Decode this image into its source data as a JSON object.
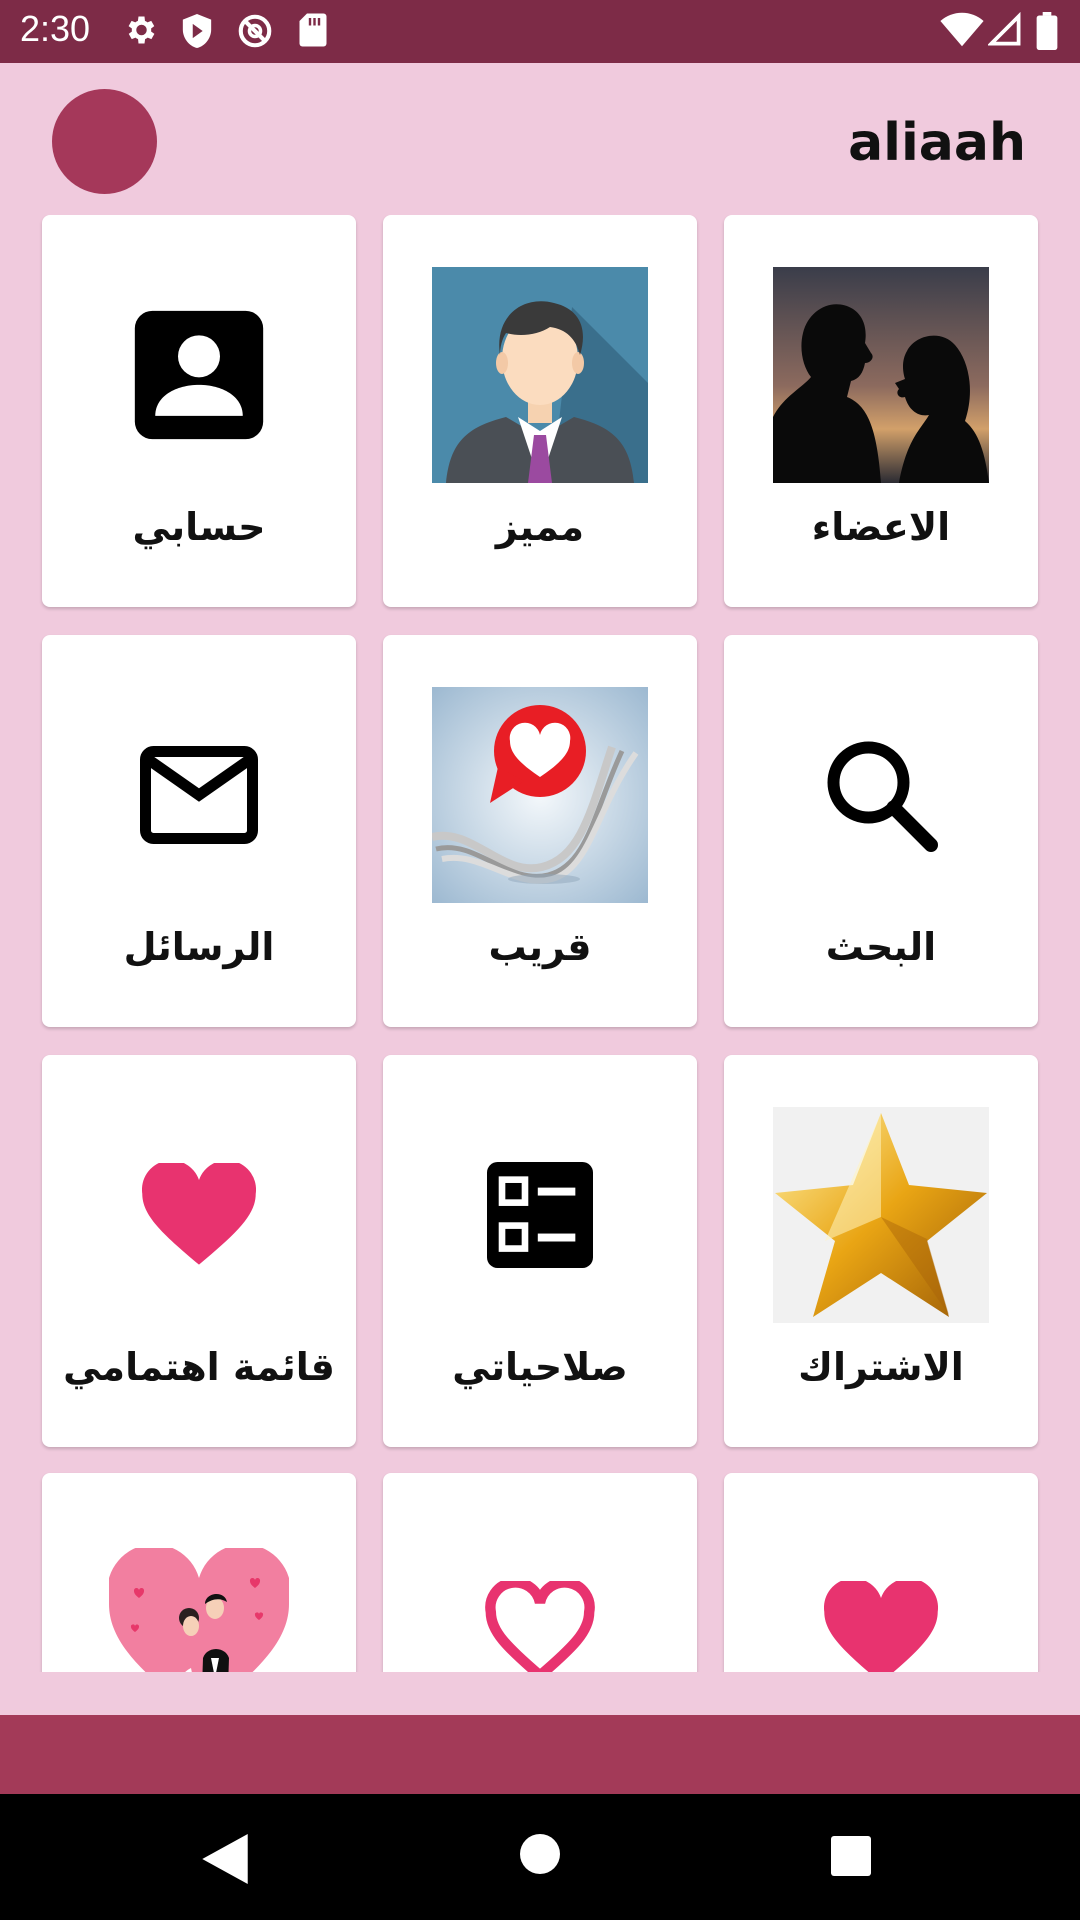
{
  "status_bar": {
    "time": "2:30",
    "icons_left": [
      "gear-icon",
      "shield-icon",
      "no-disturb-icon",
      "sd-card-icon"
    ],
    "icons_right": [
      "wifi-icon",
      "signal-icon",
      "battery-icon"
    ]
  },
  "header": {
    "title": "aliaah",
    "avatar_color": "#a5385a"
  },
  "colors": {
    "status_bar": "#7d2b47",
    "background": "#f0cadd",
    "bottom_bar": "#a33a58",
    "heart": "#e8336f"
  },
  "grid": {
    "cards": [
      {
        "label": "الاعضاء",
        "icon": "couple-photo"
      },
      {
        "label": "مميز",
        "icon": "businessman-avatar"
      },
      {
        "label": "حسابي",
        "icon": "account-box-icon"
      },
      {
        "label": "البحث",
        "icon": "search-icon"
      },
      {
        "label": "قريب",
        "icon": "chat-heart-photo"
      },
      {
        "label": "الرسائل",
        "icon": "mail-icon"
      },
      {
        "label": "الاشتراك",
        "icon": "gold-star-photo"
      },
      {
        "label": "صلاحياتي",
        "icon": "checklist-icon"
      },
      {
        "label": "قائمة اهتمامي",
        "icon": "heart-icon"
      },
      {
        "label": "",
        "icon": "heart-icon"
      },
      {
        "label": "",
        "icon": "heart-outline-icon"
      },
      {
        "label": "",
        "icon": "wedding-couple-heart"
      }
    ]
  },
  "nav_bar": {
    "buttons": [
      "back-icon",
      "home-icon",
      "recents-icon"
    ]
  }
}
